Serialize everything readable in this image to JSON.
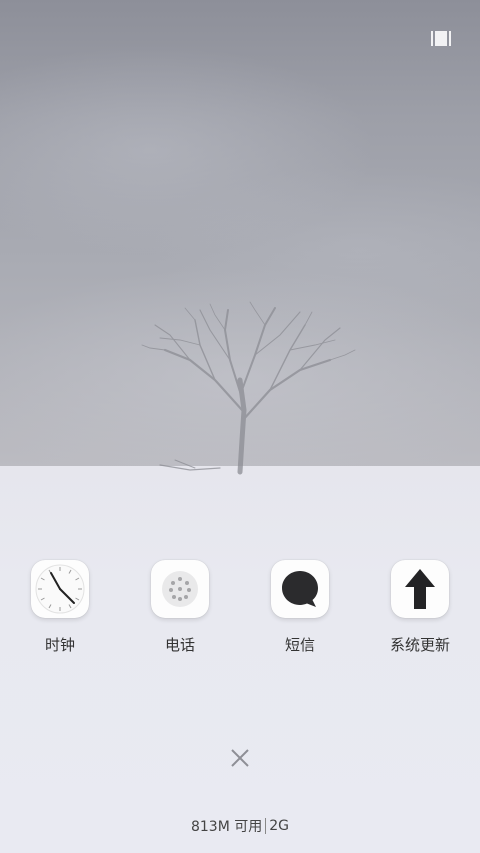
{
  "apps": [
    {
      "label": "时钟",
      "icon": "clock-icon"
    },
    {
      "label": "电话",
      "icon": "phone-dialpad-icon"
    },
    {
      "label": "短信",
      "icon": "message-bubble-icon"
    },
    {
      "label": "系统更新",
      "icon": "arrow-up-icon"
    }
  ],
  "memory": {
    "free": "813M 可用",
    "network": "2G"
  },
  "icons": {
    "recent_toggle": "recent-layout-icon",
    "close": "close-icon"
  },
  "colors": {
    "sky": "#a0a2ab",
    "snow": "#e9eaf2",
    "label_text": "#333333"
  }
}
